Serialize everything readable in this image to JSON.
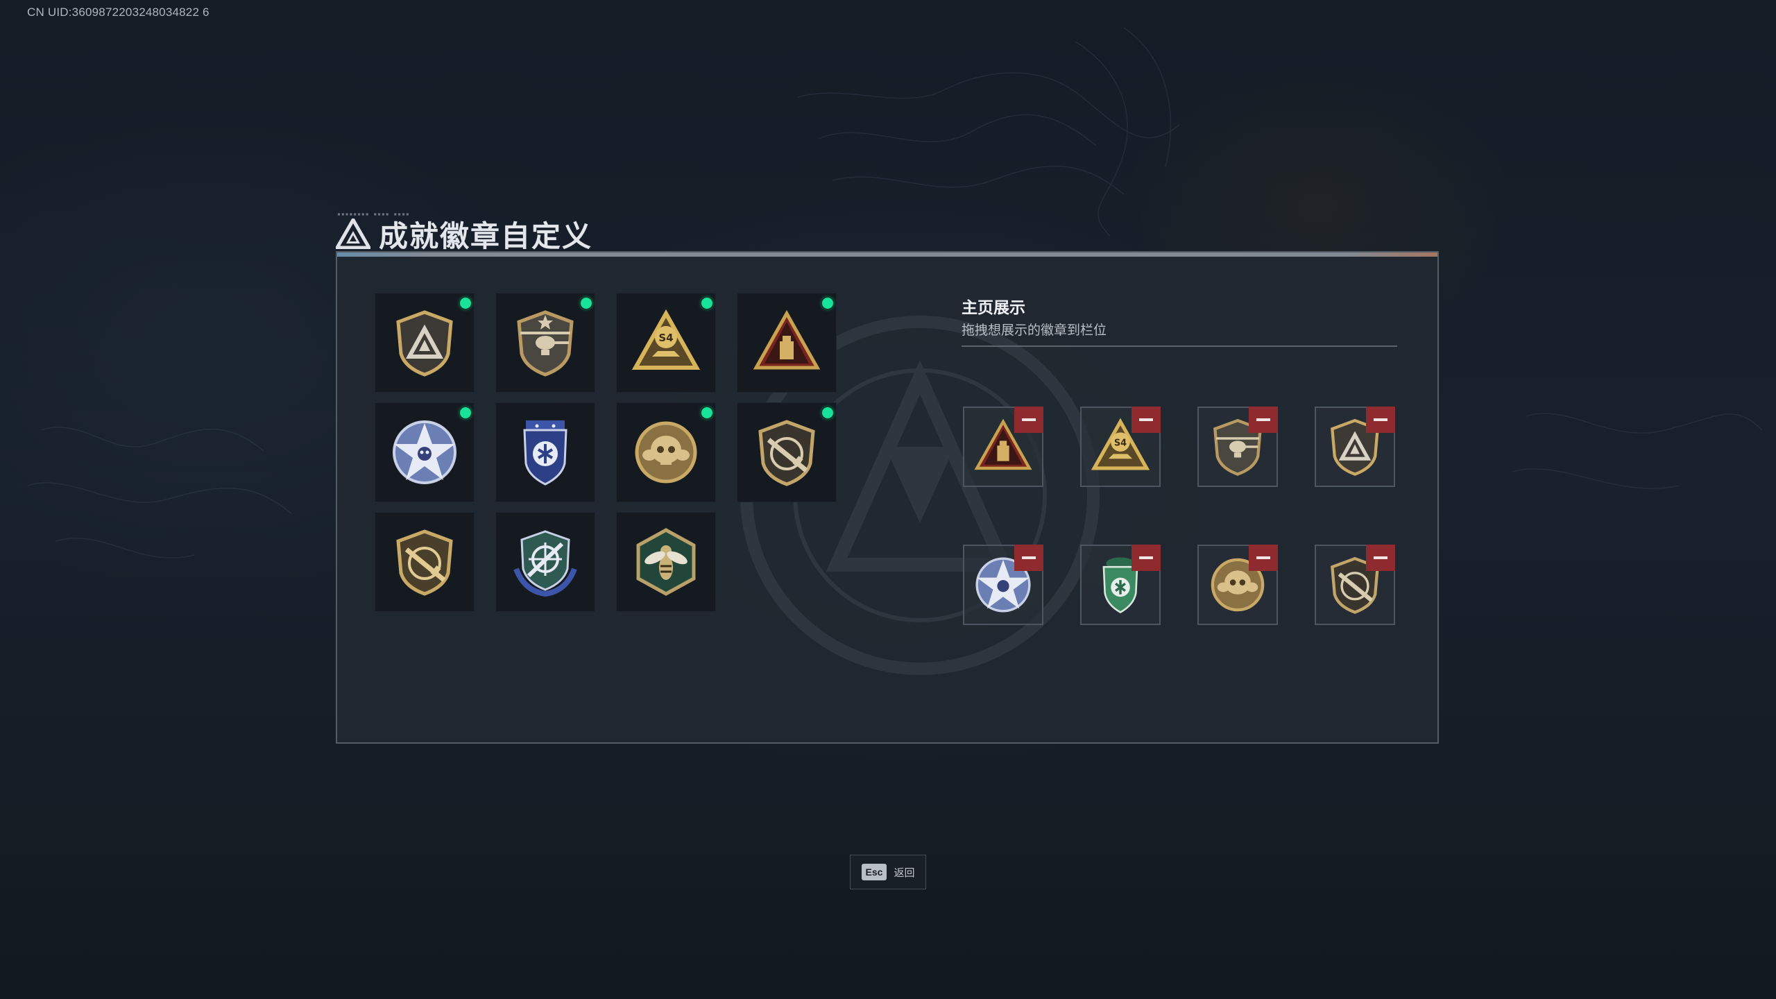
{
  "uid": "CN UID:3609872203248034822 6",
  "title": "成就徽章自定义",
  "title_deco": "▪▪▪▪▪▪▪▪ ▪▪▪▪ ▪▪▪▪",
  "colors": {
    "accent_green": "#19e39a",
    "remove_red": "#8f2a2f",
    "badge_gold": "#c9a966"
  },
  "badges": [
    {
      "icon": "triangle-shield-badge-icon",
      "selected": true
    },
    {
      "icon": "helicopter-shield-badge-icon",
      "selected": true
    },
    {
      "icon": "s4-triangle-badge-icon",
      "selected": true
    },
    {
      "icon": "red-triangle-badge-icon",
      "selected": true
    },
    {
      "icon": "blue-star-skull-badge-icon",
      "selected": true
    },
    {
      "icon": "blue-wing-badge-icon",
      "selected": false
    },
    {
      "icon": "gold-skull-badge-icon",
      "selected": true
    },
    {
      "icon": "rifle-shield-badge-icon",
      "selected": true
    },
    {
      "icon": "gold-rifle-shield-badge-icon",
      "selected": false
    },
    {
      "icon": "green-crosshair-badge-icon",
      "selected": false
    },
    {
      "icon": "wasp-hexagon-badge-icon",
      "selected": false
    }
  ],
  "showcase": {
    "title": "主页展示",
    "subtitle": "拖拽想展示的徽章到栏位",
    "slots": [
      {
        "icon": "red-triangle-badge-icon"
      },
      {
        "icon": "s4-triangle-badge-icon"
      },
      {
        "icon": "helicopter-shield-badge-icon"
      },
      {
        "icon": "triangle-shield-badge-icon"
      },
      {
        "icon": "blue-star-skull-badge-icon"
      },
      {
        "icon": "green-beret-shield-badge-icon"
      },
      {
        "icon": "gold-skull-badge-icon"
      },
      {
        "icon": "rifle-shield-badge-icon"
      }
    ]
  },
  "footer": {
    "esc_key": "Esc",
    "esc_label": "返回"
  }
}
